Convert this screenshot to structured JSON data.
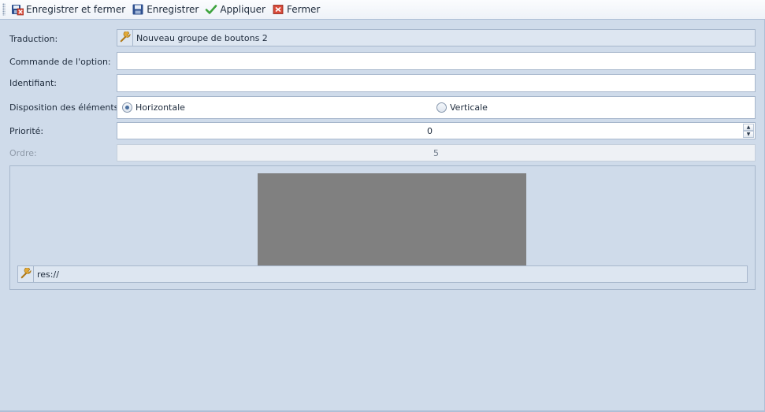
{
  "toolbar": {
    "save_close_label": "Enregistrer et fermer",
    "save_label": "Enregistrer",
    "apply_label": "Appliquer",
    "close_label": "Fermer"
  },
  "form": {
    "translation_label": "Traduction:",
    "translation_value": "Nouveau groupe de boutons 2",
    "command_label": "Commande de l'option:",
    "command_value": "",
    "identifier_label": "Identifiant:",
    "identifier_value": "",
    "layout_label": "Disposition des éléments:",
    "layout_options": [
      "Horizontale",
      "Verticale"
    ],
    "layout_selected": "Horizontale",
    "priority_label": "Priorité:",
    "priority_value": "0",
    "order_label": "Ordre:",
    "order_value": "5"
  },
  "image_group": {
    "resource_value": "res://"
  },
  "colors": {
    "background": "#cfdbea",
    "preview_fill": "#808080",
    "apply_check": "#3da33d",
    "close_red": "#d94a3a",
    "save_blue": "#2d4f8f"
  },
  "icons": [
    "save-close-icon",
    "save-icon",
    "check-icon",
    "close-icon",
    "wrench-icon"
  ]
}
